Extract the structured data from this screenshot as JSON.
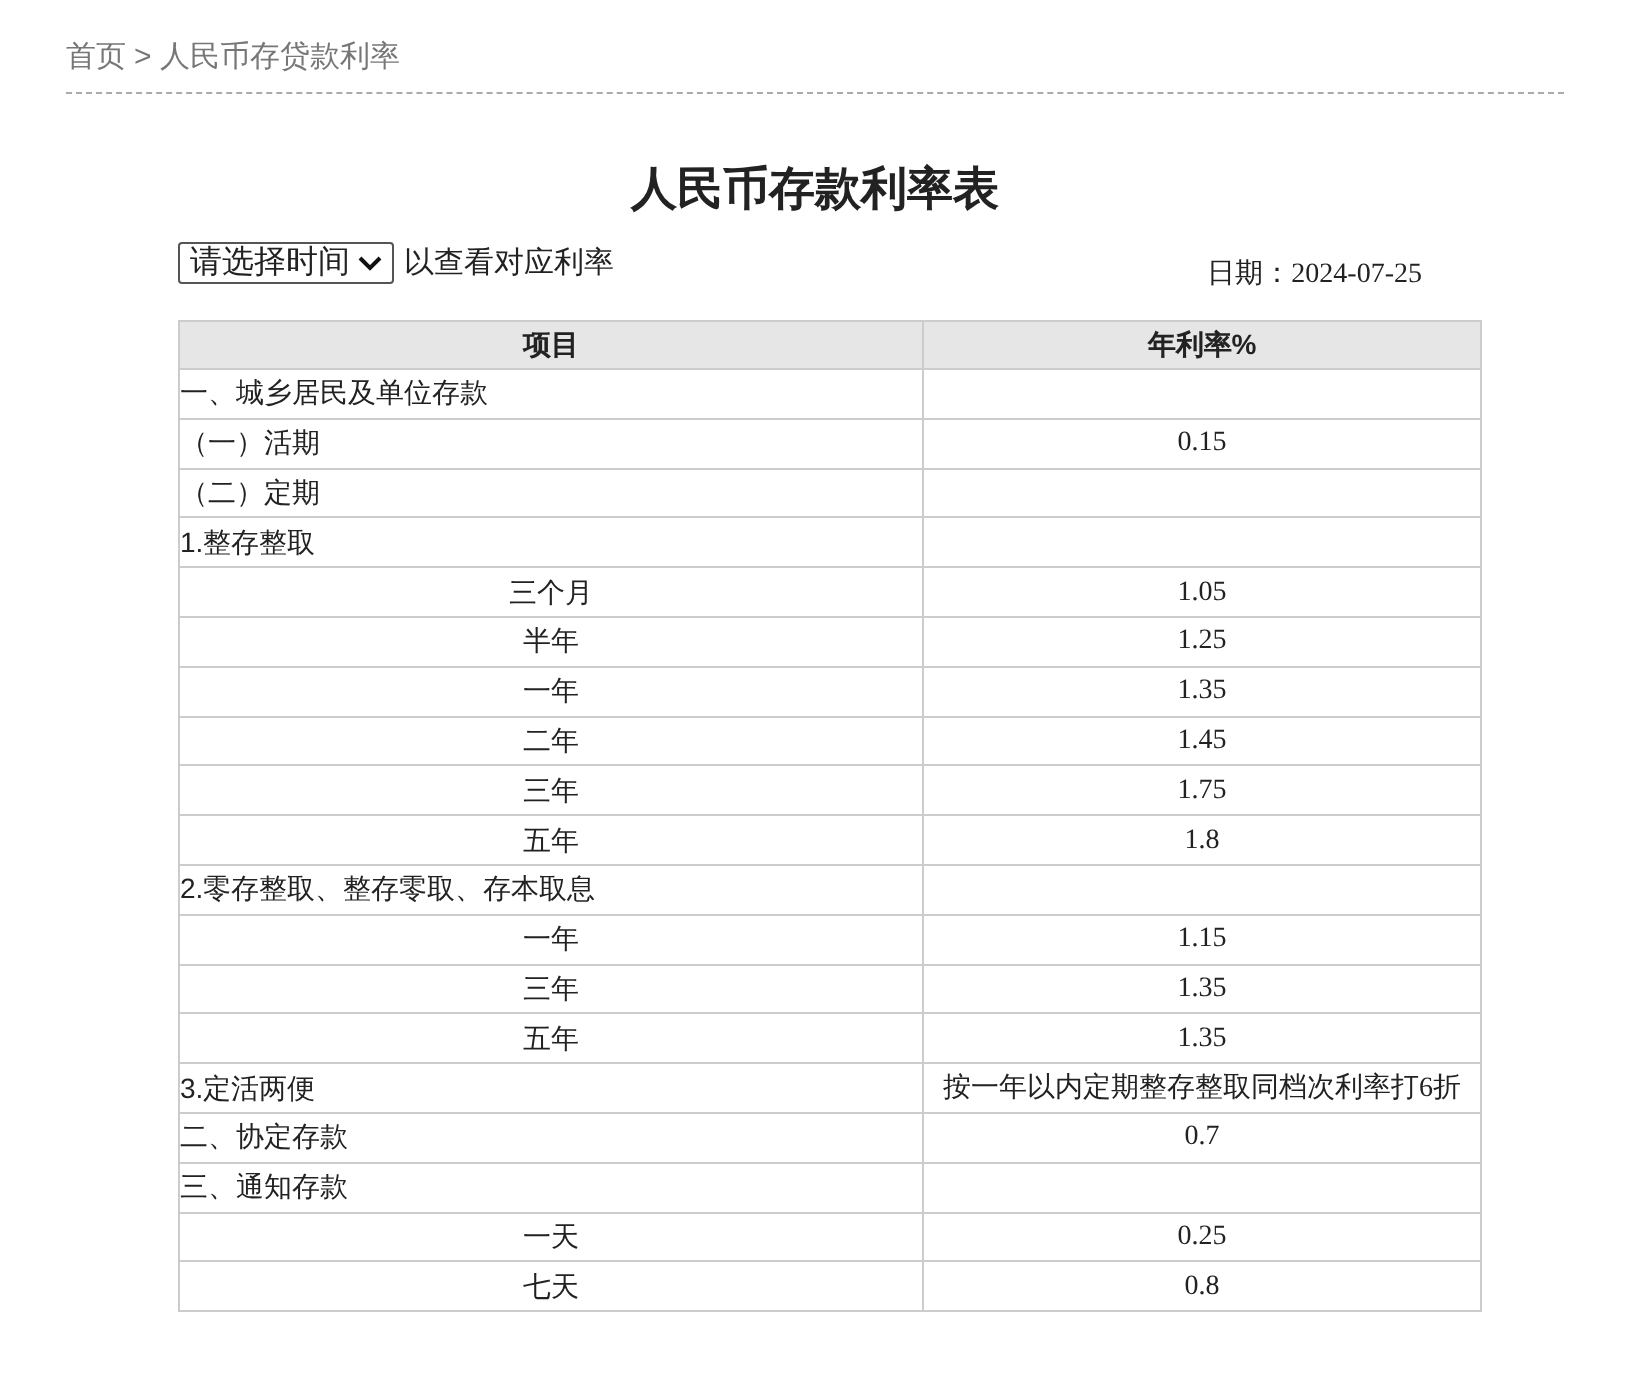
{
  "breadcrumb": {
    "home": "首页",
    "separator": ">",
    "current": "人民币存贷款利率"
  },
  "title": "人民币存款利率表",
  "filter": {
    "select": "请选择时间",
    "hint": "以查看对应利率",
    "date_label": "日期：",
    "date": "2024-07-25"
  },
  "table": {
    "columns": [
      "项目",
      "年利率%"
    ],
    "rows": [
      {
        "kind": "section",
        "item": "一、城乡居民及单位存款",
        "rate": ""
      },
      {
        "kind": "section",
        "item": "（一）活期",
        "rate": "0.15"
      },
      {
        "kind": "section",
        "item": "（二）定期",
        "rate": ""
      },
      {
        "kind": "section",
        "item": "1.整存整取",
        "rate": ""
      },
      {
        "kind": "term",
        "item": "三个月",
        "rate": "1.05"
      },
      {
        "kind": "term",
        "item": "半年",
        "rate": "1.25"
      },
      {
        "kind": "term",
        "item": "一年",
        "rate": "1.35"
      },
      {
        "kind": "term",
        "item": "二年",
        "rate": "1.45"
      },
      {
        "kind": "term",
        "item": "三年",
        "rate": "1.75"
      },
      {
        "kind": "term",
        "item": "五年",
        "rate": "1.8"
      },
      {
        "kind": "section",
        "item": "2.零存整取、整存零取、存本取息",
        "rate": ""
      },
      {
        "kind": "term",
        "item": "一年",
        "rate": "1.15"
      },
      {
        "kind": "term",
        "item": "三年",
        "rate": "1.35"
      },
      {
        "kind": "term",
        "item": "五年",
        "rate": "1.35"
      },
      {
        "kind": "section",
        "item": "3.定活两便",
        "rate": "按一年以内定期整存整取同档次利率打6折"
      },
      {
        "kind": "section",
        "item": "二、协定存款",
        "rate": "0.7"
      },
      {
        "kind": "section",
        "item": "三、通知存款",
        "rate": ""
      },
      {
        "kind": "term",
        "item": "一天",
        "rate": "0.25"
      },
      {
        "kind": "term",
        "item": "七天",
        "rate": "0.8"
      }
    ]
  }
}
